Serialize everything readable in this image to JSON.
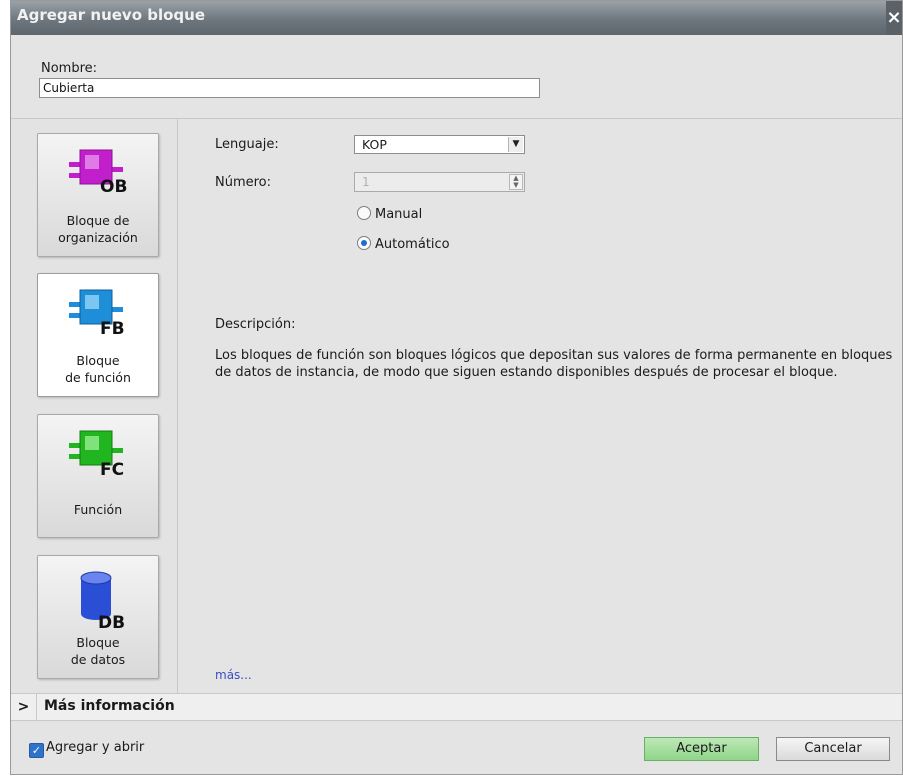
{
  "dialog": {
    "title": "Agregar nuevo bloque",
    "close_glyph": "×"
  },
  "name_field": {
    "label": "Nombre:",
    "value": "Cubierta"
  },
  "blocks": [
    {
      "label_line1": "Bloque de",
      "label_line2": "organización",
      "badge": "OB",
      "color": "#c21fcc",
      "selected": false
    },
    {
      "label_line1": "Bloque",
      "label_line2": "de función",
      "badge": "FB",
      "color": "#1f8ed8",
      "selected": true
    },
    {
      "label_line1": "Función",
      "label_line2": "",
      "badge": "FC",
      "color": "#21b51f",
      "selected": false
    },
    {
      "label_line1": "Bloque",
      "label_line2": "de datos",
      "badge": "DB",
      "color": "#2a4ed6",
      "selected": false
    }
  ],
  "settings": {
    "language_label": "Lenguaje:",
    "language_value": "KOP",
    "number_label": "Número:",
    "number_value": "1",
    "radio_manual": "Manual",
    "radio_auto": "Automático",
    "number_mode": "Automático"
  },
  "description": {
    "title": "Descripción:",
    "text": "Los bloques de función son bloques lógicos que depositan sus valores de forma permanente en bloques de datos de instancia, de modo que siguen estando disponibles después de procesar el bloque.",
    "more_link": "más..."
  },
  "more_info": {
    "chevron": ">",
    "label": "Más información"
  },
  "footer": {
    "checkbox_label": "Agregar y abrir",
    "checkbox_checked": true,
    "accept": "Aceptar",
    "cancel": "Cancelar"
  },
  "icons": [
    "close-icon",
    "ob-block-icon",
    "fb-block-icon",
    "fc-block-icon",
    "db-block-icon",
    "dropdown-arrow-icon",
    "spin-arrows-icon",
    "chevron-right-icon",
    "checkmark-icon"
  ]
}
